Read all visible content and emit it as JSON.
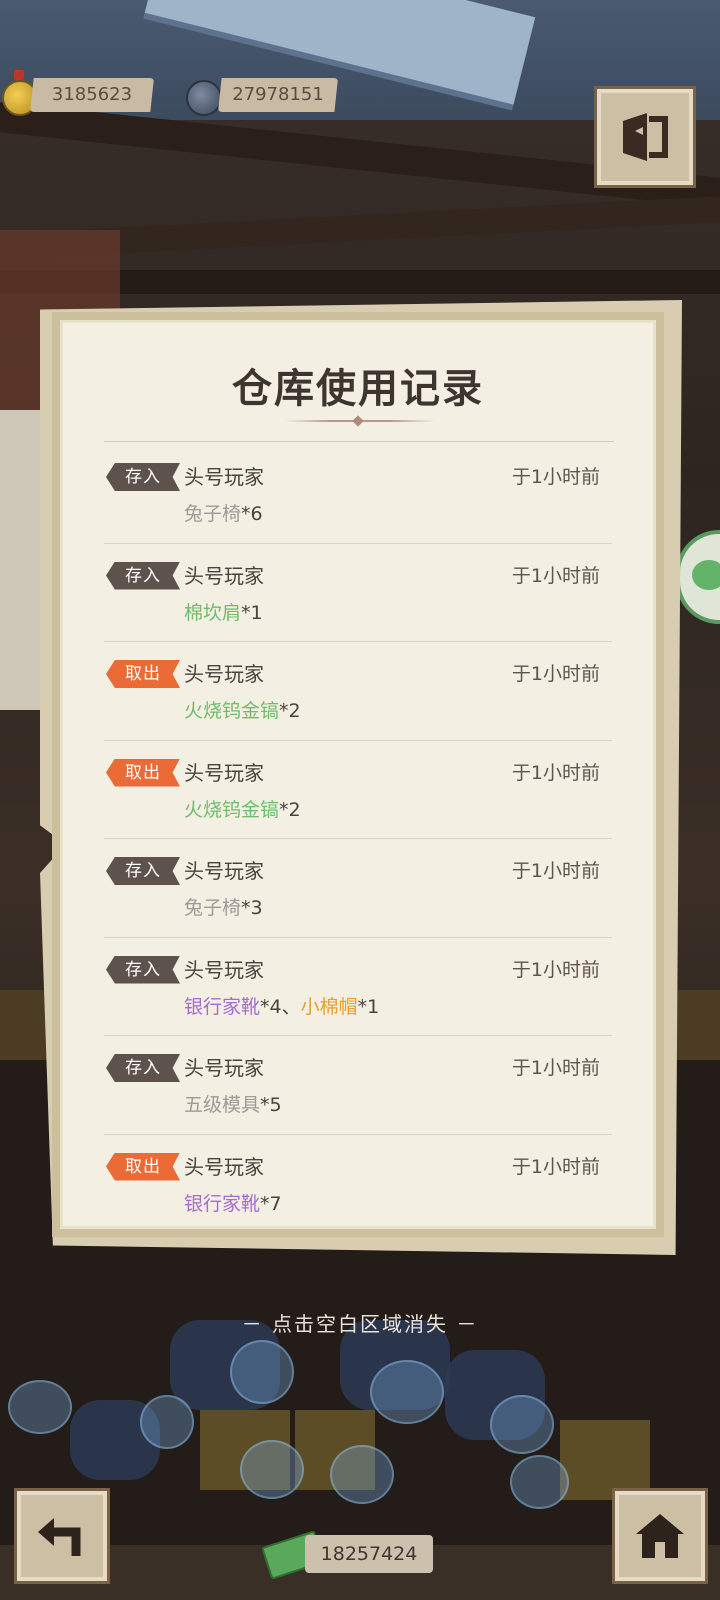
{
  "currency": {
    "coins": "3185623",
    "ore": "27978151",
    "money": "18257424"
  },
  "icons": {
    "coin": "gold-medal-coin",
    "ore": "ore-coin",
    "money": "green-banknote",
    "exit": "exit-door",
    "back": "back-arrow",
    "home": "home-house",
    "chat": "chat-bubble"
  },
  "panel": {
    "title": "仓库使用记录",
    "records": [
      {
        "action": "存入",
        "type": "store",
        "player": "头号玩家",
        "time": "于1小时前",
        "items": [
          {
            "name": "兔子椅",
            "qty": "*6",
            "rarity": "gray"
          }
        ]
      },
      {
        "action": "存入",
        "type": "store",
        "player": "头号玩家",
        "time": "于1小时前",
        "items": [
          {
            "name": "棉坎肩",
            "qty": "*1",
            "rarity": "green"
          }
        ]
      },
      {
        "action": "取出",
        "type": "take",
        "player": "头号玩家",
        "time": "于1小时前",
        "items": [
          {
            "name": "火烧钨金镐",
            "qty": "*2",
            "rarity": "green"
          }
        ]
      },
      {
        "action": "取出",
        "type": "take",
        "player": "头号玩家",
        "time": "于1小时前",
        "items": [
          {
            "name": "火烧钨金镐",
            "qty": "*2",
            "rarity": "green"
          }
        ]
      },
      {
        "action": "存入",
        "type": "store",
        "player": "头号玩家",
        "time": "于1小时前",
        "items": [
          {
            "name": "兔子椅",
            "qty": "*3",
            "rarity": "gray"
          }
        ]
      },
      {
        "action": "存入",
        "type": "store",
        "player": "头号玩家",
        "time": "于1小时前",
        "items": [
          {
            "name": "银行家靴",
            "qty": "*4",
            "rarity": "purple",
            "sep": "、"
          },
          {
            "name": "小棉帽",
            "qty": "*1",
            "rarity": "orange"
          }
        ]
      },
      {
        "action": "存入",
        "type": "store",
        "player": "头号玩家",
        "time": "于1小时前",
        "items": [
          {
            "name": "五级模具",
            "qty": "*5",
            "rarity": "gray"
          }
        ]
      },
      {
        "action": "取出",
        "type": "take",
        "player": "头号玩家",
        "time": "于1小时前",
        "items": [
          {
            "name": "银行家靴",
            "qty": "*7",
            "rarity": "purple"
          }
        ]
      }
    ]
  },
  "dismiss_hint": "－ 点击空白区域消失 －",
  "colors": {
    "store_badge": "#5d524c",
    "take_badge": "#ea6b36",
    "gray": "#9e9a97",
    "green": "#6fbd6a",
    "purple": "#a86bd0",
    "orange": "#e5a12a"
  }
}
